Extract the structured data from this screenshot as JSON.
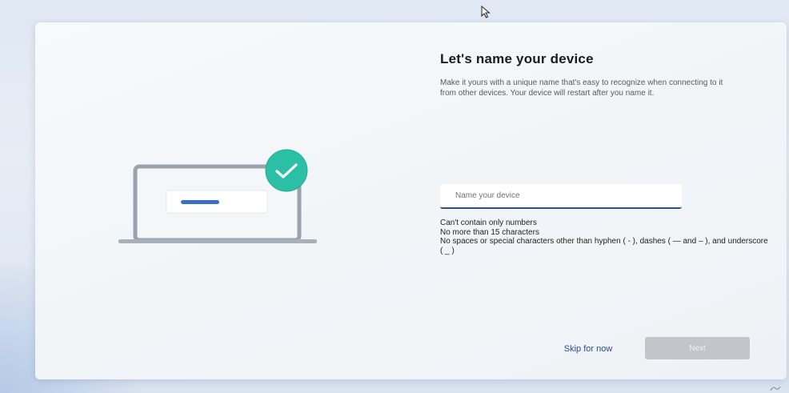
{
  "setup": {
    "title": "Let's name your device",
    "description": "Make it yours with a unique name that's easy to recognize when connecting to it from other devices. Your device will restart after you name it.",
    "name_input": {
      "value": "",
      "placeholder": "Name your device"
    },
    "rules": [
      "Can't contain only numbers",
      "No more than 15 characters",
      "No spaces or special characters other than hyphen ( - ), dashes ( — and – ), and underscore ( _ )"
    ],
    "skip_label": "Skip for now",
    "next_label": "Next",
    "next_enabled": false
  },
  "illustration": {
    "icons": [
      "laptop-icon",
      "checkmark-badge-icon"
    ],
    "accent_color": "#2bc0a5",
    "bar_color": "#3b6fc4"
  },
  "colors": {
    "link": "#2b4f8a",
    "disabled_button": "#c2c6cb"
  }
}
